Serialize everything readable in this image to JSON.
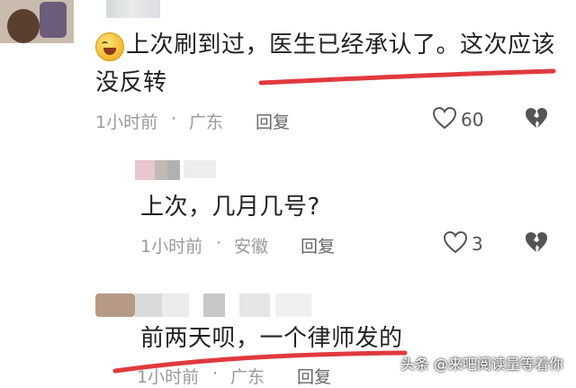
{
  "comments": [
    {
      "text_line1": "上次刷到过，医生已经承认了。这次应该",
      "text_line2": "没反转",
      "time": "1小时前",
      "dot": "·",
      "location": "广东",
      "reply_label": "回复",
      "likes": "60"
    },
    {
      "text": "上次，几月几号?",
      "time": "1小时前",
      "dot": "·",
      "location": "安徽",
      "reply_label": "回复",
      "likes": "3"
    },
    {
      "text": "前两天呗，一个律师发的",
      "time": "1小时前",
      "dot": "·",
      "location": "广东",
      "reply_label": "回复"
    }
  ],
  "watermark": "头条 @来吧阅读量等着你",
  "icons": {
    "like": "heart-outline-icon",
    "dislike": "broken-heart-icon",
    "emoji": "laughing-emoji-icon"
  },
  "colors": {
    "underline": "#e03a3e",
    "meta_gray": "#9a9a9a",
    "text": "#222222"
  }
}
